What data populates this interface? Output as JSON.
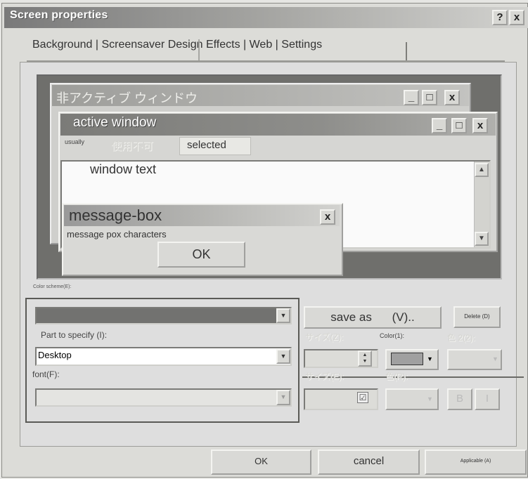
{
  "window": {
    "title": "Screen properties",
    "help_button": "?",
    "close_button": "x"
  },
  "tabs": {
    "label": "Background | Screensaver Design Effects | Web | Settings"
  },
  "preview": {
    "inactive_title": "非アクティブ ウィンドウ",
    "active_title": "active window",
    "menu_usually": "usually",
    "menu_disabled": "使用不可",
    "menu_selected": "selected",
    "window_text": "window text",
    "msgbox_title": "message-box",
    "msgbox_chars": "message pox characters",
    "ok": "OK",
    "min_btn": "_",
    "max_btn": "□",
    "close_btn": "x",
    "scroll_up": "▲",
    "scroll_down": "▼"
  },
  "scheme": {
    "label": "Color scheme(E):",
    "value": ""
  },
  "part": {
    "label": "Part to specify (I):",
    "value": "Desktop"
  },
  "font": {
    "label": "font(F):",
    "value": ""
  },
  "buttons": {
    "save_as": "save as",
    "save_as_key": "(V)..",
    "delete": "Delete (D)",
    "ok": "OK",
    "cancel": "cancel",
    "apply": "Applicable (A)"
  },
  "right_panel": {
    "size_label": "サイズ(Z):",
    "color1_label": "Color(1):",
    "color2_label": "色 2(2):",
    "size2_label": "サイズ(E):",
    "color3_label": "色(R):",
    "bold": "B",
    "italic": "I"
  },
  "colors": {
    "title_dark": "#7b7b78",
    "color1_swatch": "#a0a0a0"
  }
}
